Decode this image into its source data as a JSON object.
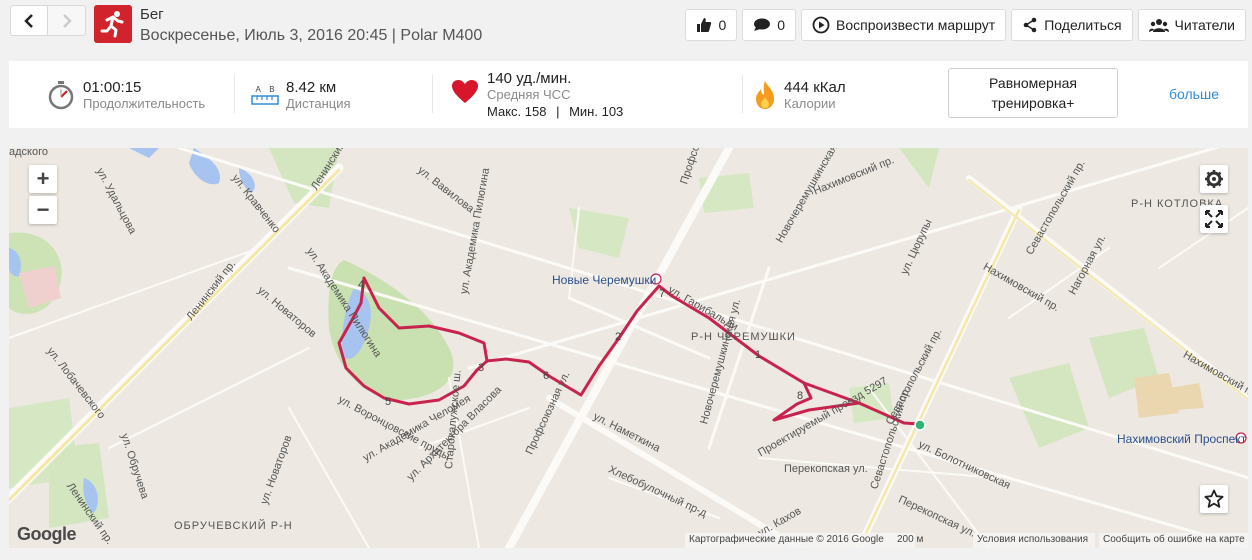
{
  "header": {
    "title": "Бег",
    "subtitle": "Воскресенье, Июль 3, 2016 20:45 | Polar M400",
    "sport_color": "#d0232b",
    "nav_prev_icon": "chevron-left-icon",
    "nav_next_icon": "chevron-right-icon"
  },
  "actions": {
    "likes": "0",
    "comments": "0",
    "replay": "Воспроизвести маршрут",
    "share": "Поделиться",
    "readers": "Читатели"
  },
  "stats": {
    "duration": {
      "value": "01:00:15",
      "label": "Продолжительность"
    },
    "distance": {
      "ab": "A    B",
      "value": "8.42 км",
      "label": "Дистанция"
    },
    "heart": {
      "value": "140 уд./мин.",
      "label": "Средняя ЧСС",
      "max": "Макс. 158",
      "divider": "|",
      "min": "Мин. 103"
    },
    "calories": {
      "value": "444 кКал",
      "label": "Калории"
    },
    "training_line1": "Равномерная",
    "training_line2": "тренировка+",
    "more": "больше"
  },
  "map": {
    "route_color": "#c8234e",
    "zoom_in": "+",
    "zoom_out": "−",
    "labels": {
      "l1": "адского",
      "l2": "ул. Удальцова",
      "l3": "ул. Кравченко",
      "l4": "Ленинский пр.",
      "l5": "ул. Новаторов",
      "l6": "ул. Академика Пилюгина",
      "l7": "ул. Вавилова",
      "l8": "ул. Академика Пилюгина",
      "l9": "Профсоюзная",
      "l10": "ул. Гарибальди",
      "l11": "Нахимовский пр.",
      "l12": "Новочеремушкинская ул.",
      "l13": "ул. Цюрупы",
      "l14": "Севастопольский пр.",
      "l15": "Р-Н КОТЛОВКА",
      "l16": "Нахимовский пр.",
      "l17": "Нагорная ул.",
      "l18": "Р-Н ЧЕРЕМУШКИ",
      "l19": "ул. Лобачевского",
      "l20": "ул. Академика Челомея",
      "l21": "ул. Архитектора Власова",
      "l22": "ул. Воронцовские пруды",
      "l23": "ул. Наметкина",
      "l24": "Профсоюзная ул.",
      "l25": "Новочеремушкинская ул.",
      "l26": "Проектируемый проезд 5297",
      "l27": "Перекопская ул.",
      "l28": "ул. Болотниковская",
      "l29": "Севастопольский пр.",
      "l30": "ул. Обручева",
      "l31": "Ленинский пр.",
      "l32": "Старокалужское ш.",
      "l33": "Хлебобулочный пр-д",
      "l34": "Перекопская ул.",
      "l35": "ОБРУЧЕВСКИЙ Р-Н",
      "l36": "ул. Кахов",
      "l37": "ул. Новаторов",
      "l38": "Севастопольский пр.",
      "l39": "Ленинский пр.",
      "l40": "Нахимовский пр."
    },
    "station1": "Новые Черемушки",
    "station2": "Нахимовский Проспект",
    "distance_marks": [
      "1",
      "2",
      "3",
      "4",
      "5",
      "6",
      "7",
      "8"
    ],
    "google": "Google",
    "map_data": "Картографические данные © 2016 Google",
    "scale": "200 м",
    "terms": "Условия использования",
    "report": "Сообщить об ошибке на карте"
  }
}
